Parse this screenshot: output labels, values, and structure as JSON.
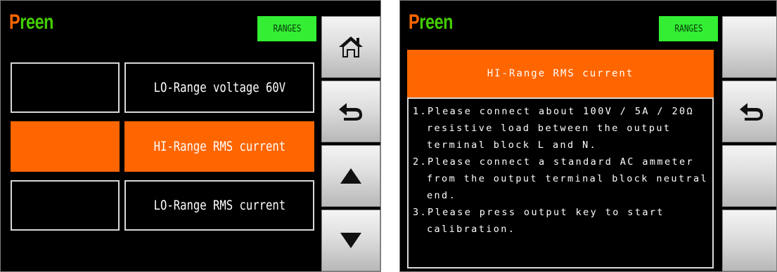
{
  "brand": {
    "first": "P",
    "rest": "reen"
  },
  "left_screen": {
    "badge": "RANGES",
    "rows": [
      {
        "label": "LO-Range voltage 60V",
        "active": false
      },
      {
        "label": "HI-Range RMS current",
        "active": true
      },
      {
        "label": "LO-Range RMS current",
        "active": false
      }
    ],
    "sidebar": [
      "home-icon",
      "back-icon",
      "arrow-up-icon",
      "arrow-down-icon"
    ]
  },
  "right_screen": {
    "badge": "RANGES",
    "title": "HI-Range RMS current",
    "instructions": [
      "1.Please connect about 100V /  5A / 20Ω",
      "resistive load between the output",
      "terminal block L and N.",
      "2.Please connect a standard AC ammeter",
      "from the output terminal block neutral",
      "end.",
      "3.Please press output key to start",
      "calibration."
    ],
    "sidebar": [
      "blank",
      "back-icon",
      "blank",
      "blank"
    ]
  },
  "colors": {
    "accent": "#ff6600",
    "badge": "#33ee33",
    "brand_rest": "#44cc00",
    "background": "#000000"
  }
}
